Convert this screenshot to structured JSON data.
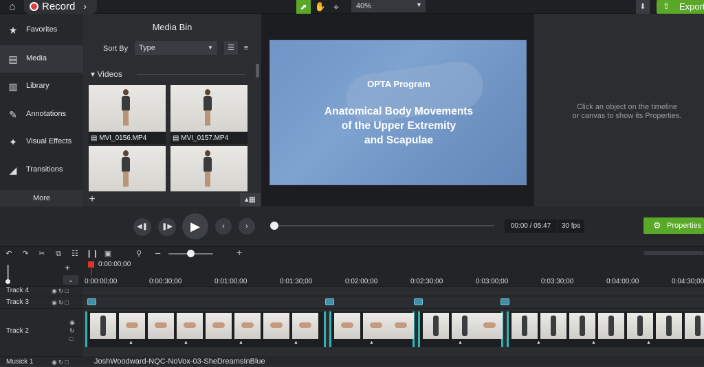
{
  "topbar": {
    "record_label": "Record",
    "zoom_value": "40%",
    "export_label": "Export"
  },
  "nav": {
    "items": [
      {
        "label": "Favorites",
        "icon": "star-icon"
      },
      {
        "label": "Media",
        "icon": "film-icon"
      },
      {
        "label": "Library",
        "icon": "library-icon"
      },
      {
        "label": "Annotations",
        "icon": "annotation-icon"
      },
      {
        "label": "Visual Effects",
        "icon": "wand-icon"
      },
      {
        "label": "Transitions",
        "icon": "transition-icon"
      }
    ],
    "more_label": "More"
  },
  "media_bin": {
    "title": "Media Bin",
    "sort_label": "Sort By",
    "sort_value": "Type",
    "section": "Videos",
    "files": [
      "MVI_0156.MP4",
      "MVI_0157.MP4"
    ]
  },
  "canvas": {
    "line1": "OPTA Program",
    "line2": "Anatomical Body Movements\nof the Upper Extremity\nand Scapulae"
  },
  "properties": {
    "empty_message": "Click an object on the timeline\nor canvas to show its Properties.",
    "button_label": "Properties"
  },
  "playback": {
    "time": "00:00 / 05:47",
    "fps": "30 fps",
    "progress": 0
  },
  "timeline": {
    "playhead_time": "0:00:00;00",
    "ruler_labels": [
      "0:00:00;00",
      "0:00:30;00",
      "0:01:00;00",
      "0:01:30;00",
      "0:02:00;00",
      "0:02:30;00",
      "0:03:00;00",
      "0:03:30;00",
      "0:04:00;00",
      "0:04:30;00"
    ],
    "tracks": [
      "Track 4",
      "Track 3",
      "Track 2",
      "Musick 1"
    ],
    "music_clip": "JoshWoodward-NQC-NoVox-03-SheDreamsInBlue"
  },
  "colors": {
    "accent": "#5aa827",
    "record": "#e23b3b",
    "clip_edge": "#2fb5b5",
    "playhead": "#d9352f"
  }
}
